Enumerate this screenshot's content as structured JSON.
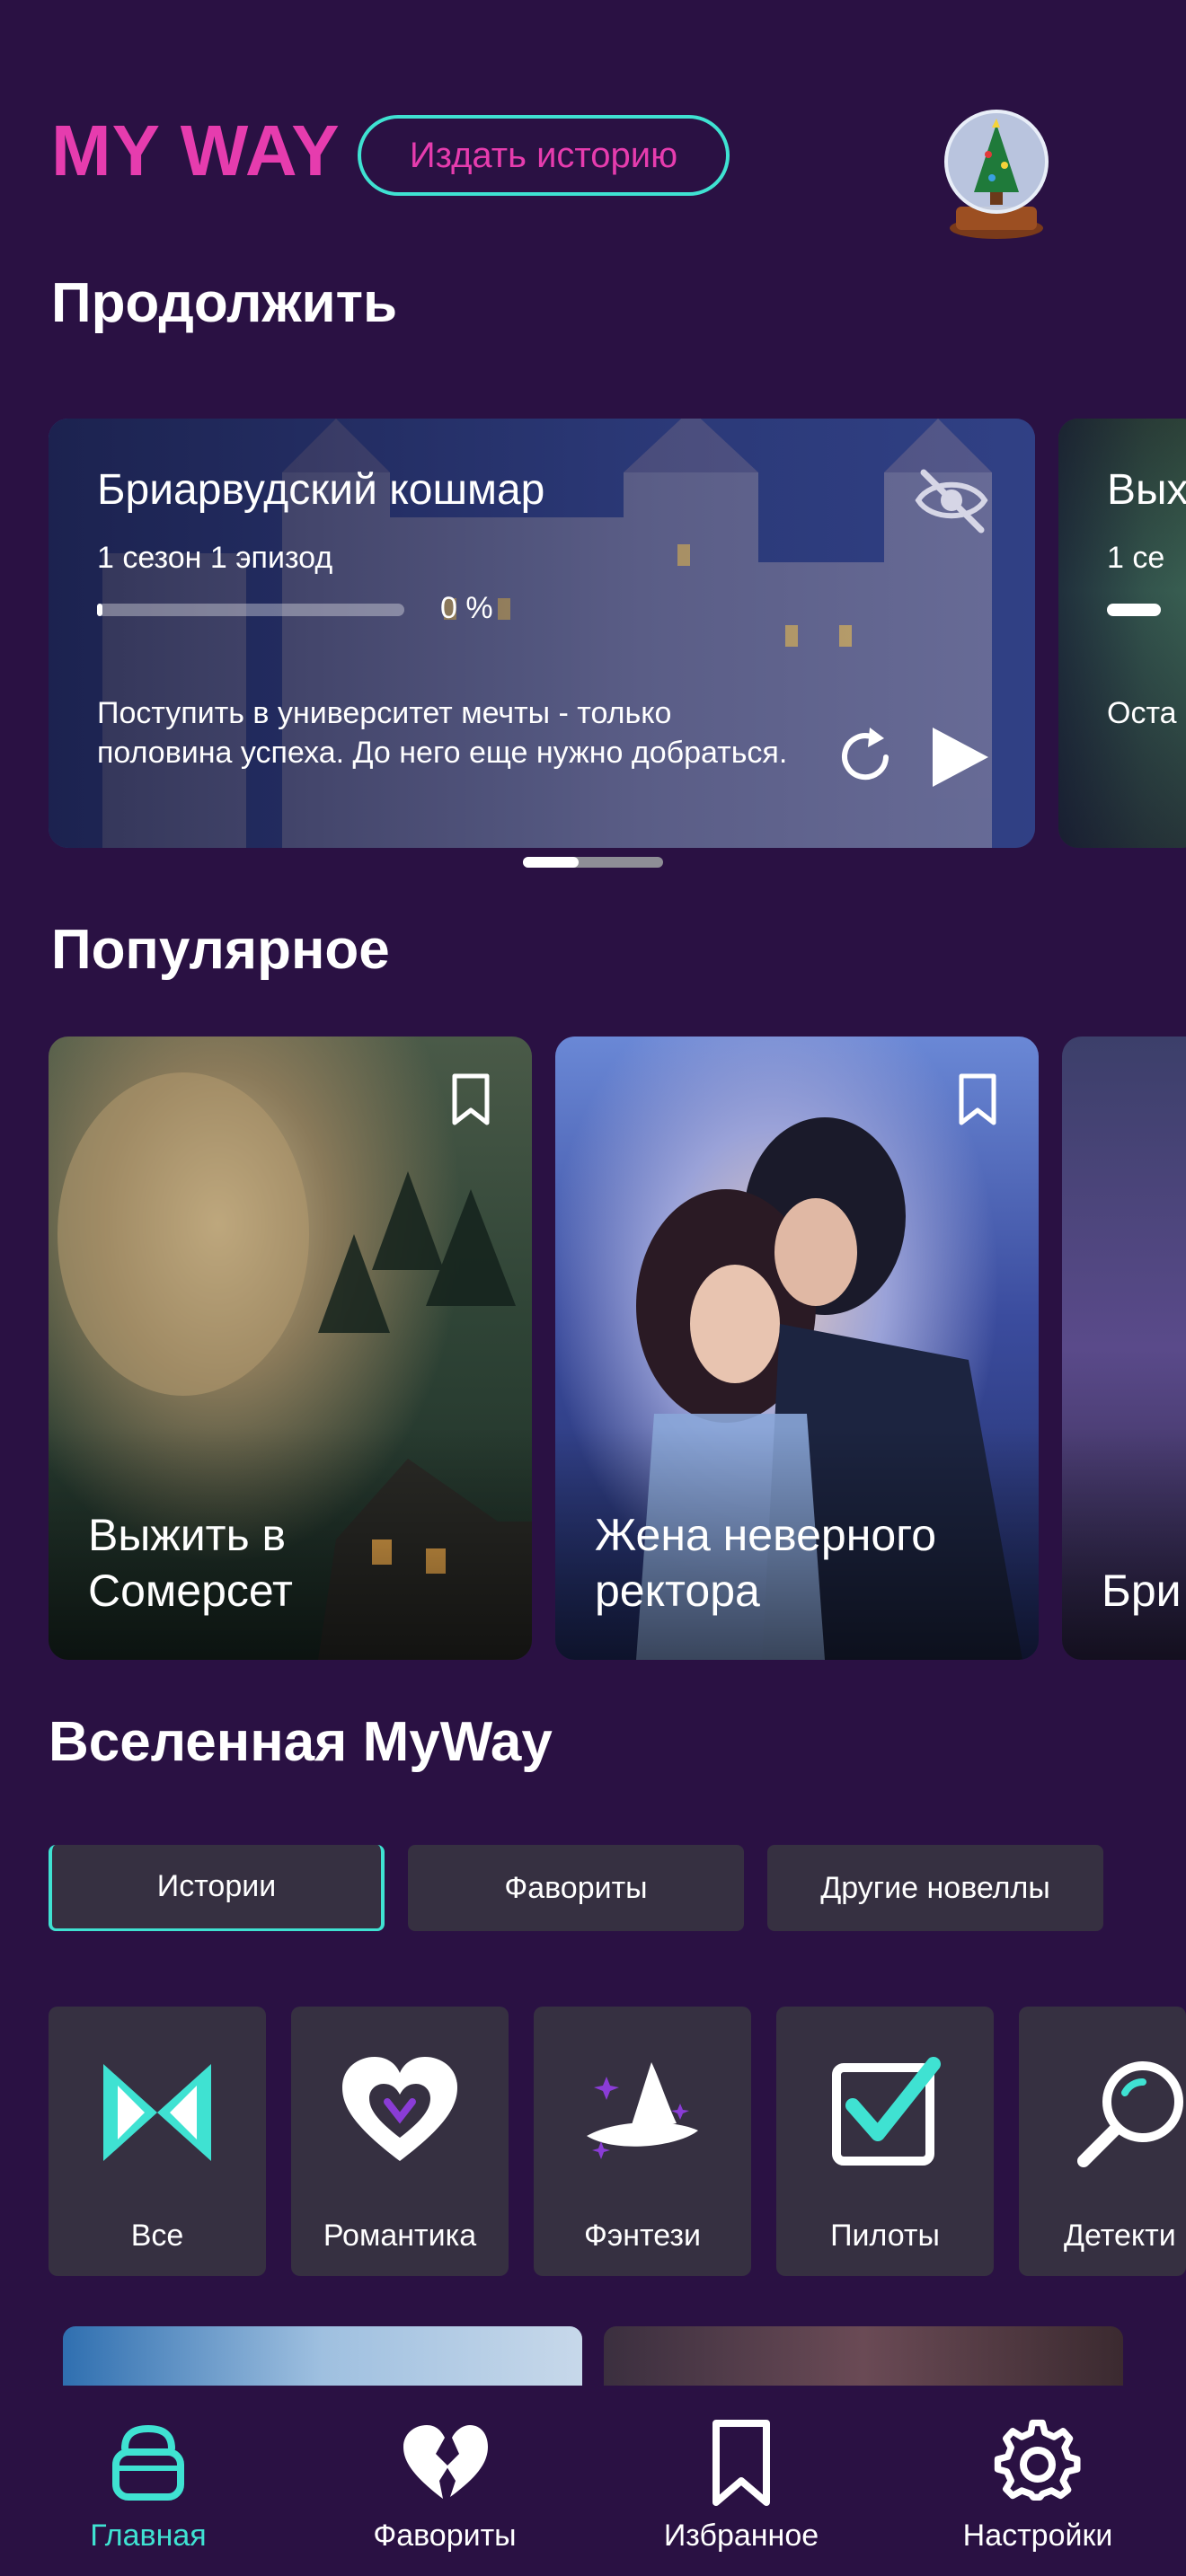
{
  "header": {
    "logo": "MY WAY",
    "publish_label": "Издать историю"
  },
  "sections": {
    "continue": "Продолжить",
    "popular": "Популярное",
    "universe": "Вселенная MyWay"
  },
  "continue_cards": [
    {
      "title": "Бриарвудский кошмар",
      "subtitle": "1 сезон 1 эпизод",
      "progress": 0,
      "progress_label": "0 %",
      "description": "Поступить в университет мечты - только половина успеха. До него еще нужно добраться."
    },
    {
      "title": "Вых",
      "subtitle": "1 се",
      "description": "Оста спок зати"
    }
  ],
  "popular": [
    {
      "title": "Выжить в Сомерсет"
    },
    {
      "title": "Жена неверного ректора"
    },
    {
      "title": "Бри кош"
    }
  ],
  "tabs": [
    {
      "label": "Истории",
      "active": true
    },
    {
      "label": "Фавориты",
      "active": false
    },
    {
      "label": "Другие новеллы",
      "active": false
    }
  ],
  "genres": [
    {
      "label": "Все",
      "icon": "myway-logo-icon"
    },
    {
      "label": "Романтика",
      "icon": "heart-icon"
    },
    {
      "label": "Фэнтези",
      "icon": "wizard-hat-icon"
    },
    {
      "label": "Пилоты",
      "icon": "checkbox-icon"
    },
    {
      "label": "Детекти",
      "icon": "magnifier-icon"
    }
  ],
  "nav": [
    {
      "label": "Главная",
      "icon": "home-icon",
      "active": true
    },
    {
      "label": "Фавориты",
      "icon": "broken-heart-icon",
      "active": false
    },
    {
      "label": "Избранное",
      "icon": "bookmark-icon",
      "active": false
    },
    {
      "label": "Настройки",
      "icon": "gear-icon",
      "active": false
    }
  ],
  "colors": {
    "background": "#2a1143",
    "accent_pink": "#e63cae",
    "accent_teal": "#3fe2d2",
    "tile": "#363041"
  }
}
